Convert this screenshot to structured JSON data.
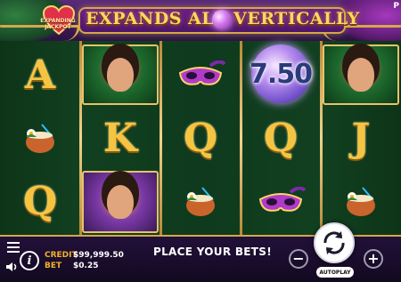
{
  "banner": {
    "logo_text": "Expanding Jackpot",
    "left_text": "EXPANDS ALL",
    "right_text": "VERTICALLY",
    "corner_label": "P"
  },
  "reels": {
    "columns": [
      [
        "A",
        "coconut-drink-icon",
        "Q"
      ],
      [
        "green-dancer-portrait",
        "K",
        "purple-dancer-portrait"
      ],
      [
        "purple-mask-icon",
        "Q",
        "coconut-drink-icon"
      ],
      [
        "multiplier-orb",
        "Q",
        "purple-mask-icon"
      ],
      [
        "green-dancer-portrait",
        "J",
        "coconut-drink-icon"
      ]
    ],
    "multiplier_value": "7.50"
  },
  "footer": {
    "credit_label": "CREDIT",
    "credit_value": "$99,999.50",
    "bet_label": "BET",
    "bet_value": "$0.25",
    "status": "PLACE YOUR BETS!",
    "minus_label": "−",
    "plus_label": "+",
    "autoplay_label": "AUTOPLAY",
    "info_label": "i"
  },
  "colors": {
    "gold": "#f5c542",
    "frame": "#d4a84a",
    "reel_bg": "#114020",
    "banner_plate": "#6a1f86",
    "credit_label": "#f2b22a"
  }
}
